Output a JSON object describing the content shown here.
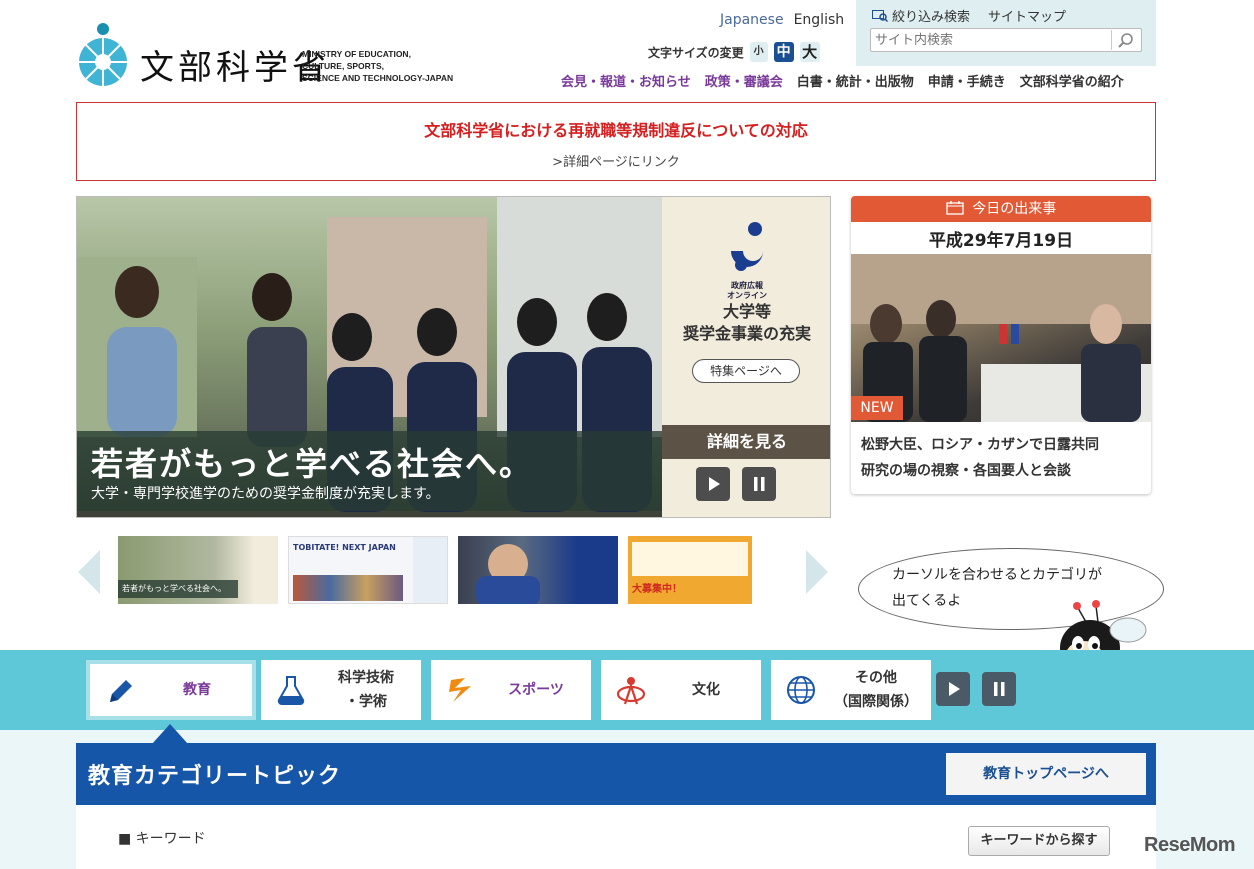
{
  "header": {
    "logo_jp": "文部科学省",
    "logo_en": [
      "MINISTRY OF EDUCATION,",
      "CULTURE, SPORTS,",
      "SCIENCE AND TECHNOLOGY-JAPAN"
    ],
    "lang": {
      "japanese": "Japanese",
      "english": "English"
    },
    "font_size": {
      "label": "文字サイズの変更",
      "small": "小",
      "medium": "中",
      "large": "大"
    },
    "search": {
      "filter_label": "絞り込み検索",
      "sitemap_label": "サイトマップ",
      "placeholder": "サイト内検索"
    },
    "nav": [
      "会見・報道・お知らせ",
      "政策・審議会",
      "白書・統計・出版物",
      "申請・手続き",
      "文部科学省の紹介"
    ]
  },
  "notice": {
    "title": "文部科学省における再就職等規制違反についての対応",
    "link": ">詳細ページにリンク"
  },
  "hero": {
    "caption_main": "若者がもっと学べる社会へ。",
    "caption_sub": "大学・専門学校進学のための奨学金制度が充実します。",
    "side_org": [
      "政府広報",
      "オンライン"
    ],
    "side_heading": [
      "大学等",
      "奨学金事業の充実"
    ],
    "side_button": "特集ページへ",
    "more": "詳細を見る"
  },
  "today": {
    "header": "今日の出来事",
    "date": "平成29年7月19日",
    "badge": "NEW",
    "text": [
      "松野大臣、ロシア・カザンで日露共同",
      "研究の場の視察・各国要人と会談"
    ]
  },
  "thumbs": [
    {
      "caption": "若者がもっと学べる社会へ。"
    },
    {
      "caption": "TOBITATE! NEXT JAPAN"
    },
    {
      "caption": ""
    },
    {
      "caption": "大募集中！"
    }
  ],
  "bubble": [
    "カーソルを合わせるとカテゴリが",
    "出てくるよ"
  ],
  "categories": [
    {
      "id": "edu",
      "label": [
        "教育"
      ],
      "color": "#7a3a9a"
    },
    {
      "id": "sci",
      "label": [
        "科学技術",
        "・学術"
      ],
      "color": "#333333"
    },
    {
      "id": "sports",
      "label": [
        "スポーツ"
      ],
      "color": "#7a3a9a"
    },
    {
      "id": "culture",
      "label": [
        "文化"
      ],
      "color": "#333333"
    },
    {
      "id": "intl",
      "label": [
        "その他",
        "（国際関係）"
      ],
      "color": "#333333"
    }
  ],
  "topic": {
    "title": "教育カテゴリートピック",
    "button": "教育トップページへ"
  },
  "keyword": {
    "label": "■ キーワード",
    "button": "キーワードから探す"
  },
  "watermark": "ReseMom"
}
